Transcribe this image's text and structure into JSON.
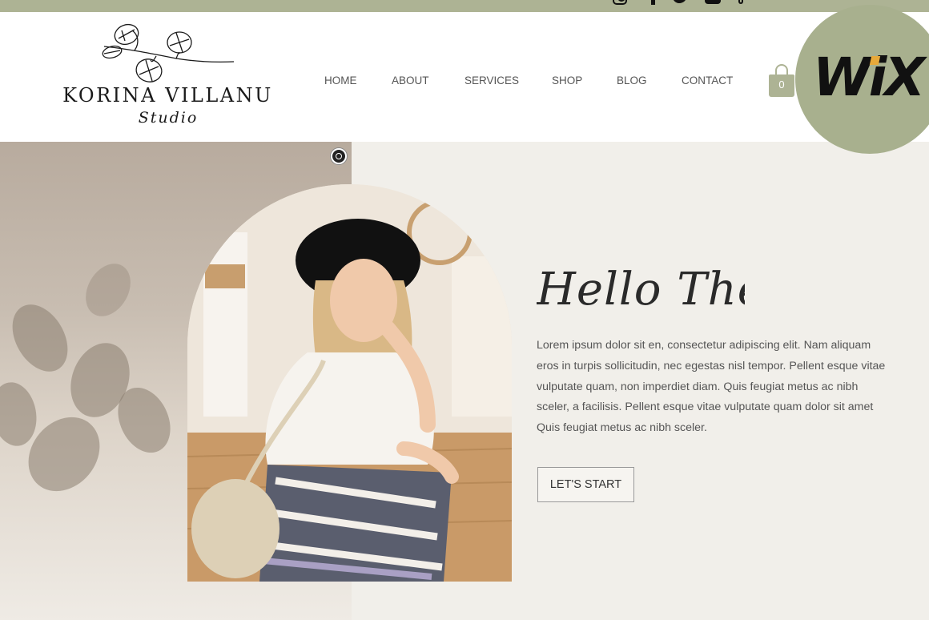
{
  "brand": {
    "name": "KORINA VILLANU",
    "subtitle": "Studio"
  },
  "social": [
    "instagram-icon",
    "facebook-icon",
    "twitter-icon",
    "youtube-icon",
    "tiktok-icon"
  ],
  "nav": [
    {
      "label": "HOME"
    },
    {
      "label": "ABOUT"
    },
    {
      "label": "SERVICES"
    },
    {
      "label": "SHOP"
    },
    {
      "label": "BLOG"
    },
    {
      "label": "CONTACT"
    }
  ],
  "cart": {
    "count": "0"
  },
  "badge": {
    "text": "WiX"
  },
  "hero": {
    "greeting": "Hello There!",
    "body": "Lorem ipsum dolor sit en, consectetur adipiscing elit. Nam aliquam eros in turpis sollicitudin, nec egestas nisl tempor. Pellent esque vitae vulputate quam, non imperdiet diam. Quis feugiat metus ac nibh sceler, a facilisis. Pellent esque vitae vulputate quam dolor sit amet Quis feugiat metus ac nibh sceler.",
    "cta": "LET'S START"
  },
  "colors": {
    "sage": "#adb394",
    "badge": "#a8b08e",
    "wix_dot": "#e7a93a",
    "hero_bg": "#f1efea",
    "text": "#555555"
  }
}
